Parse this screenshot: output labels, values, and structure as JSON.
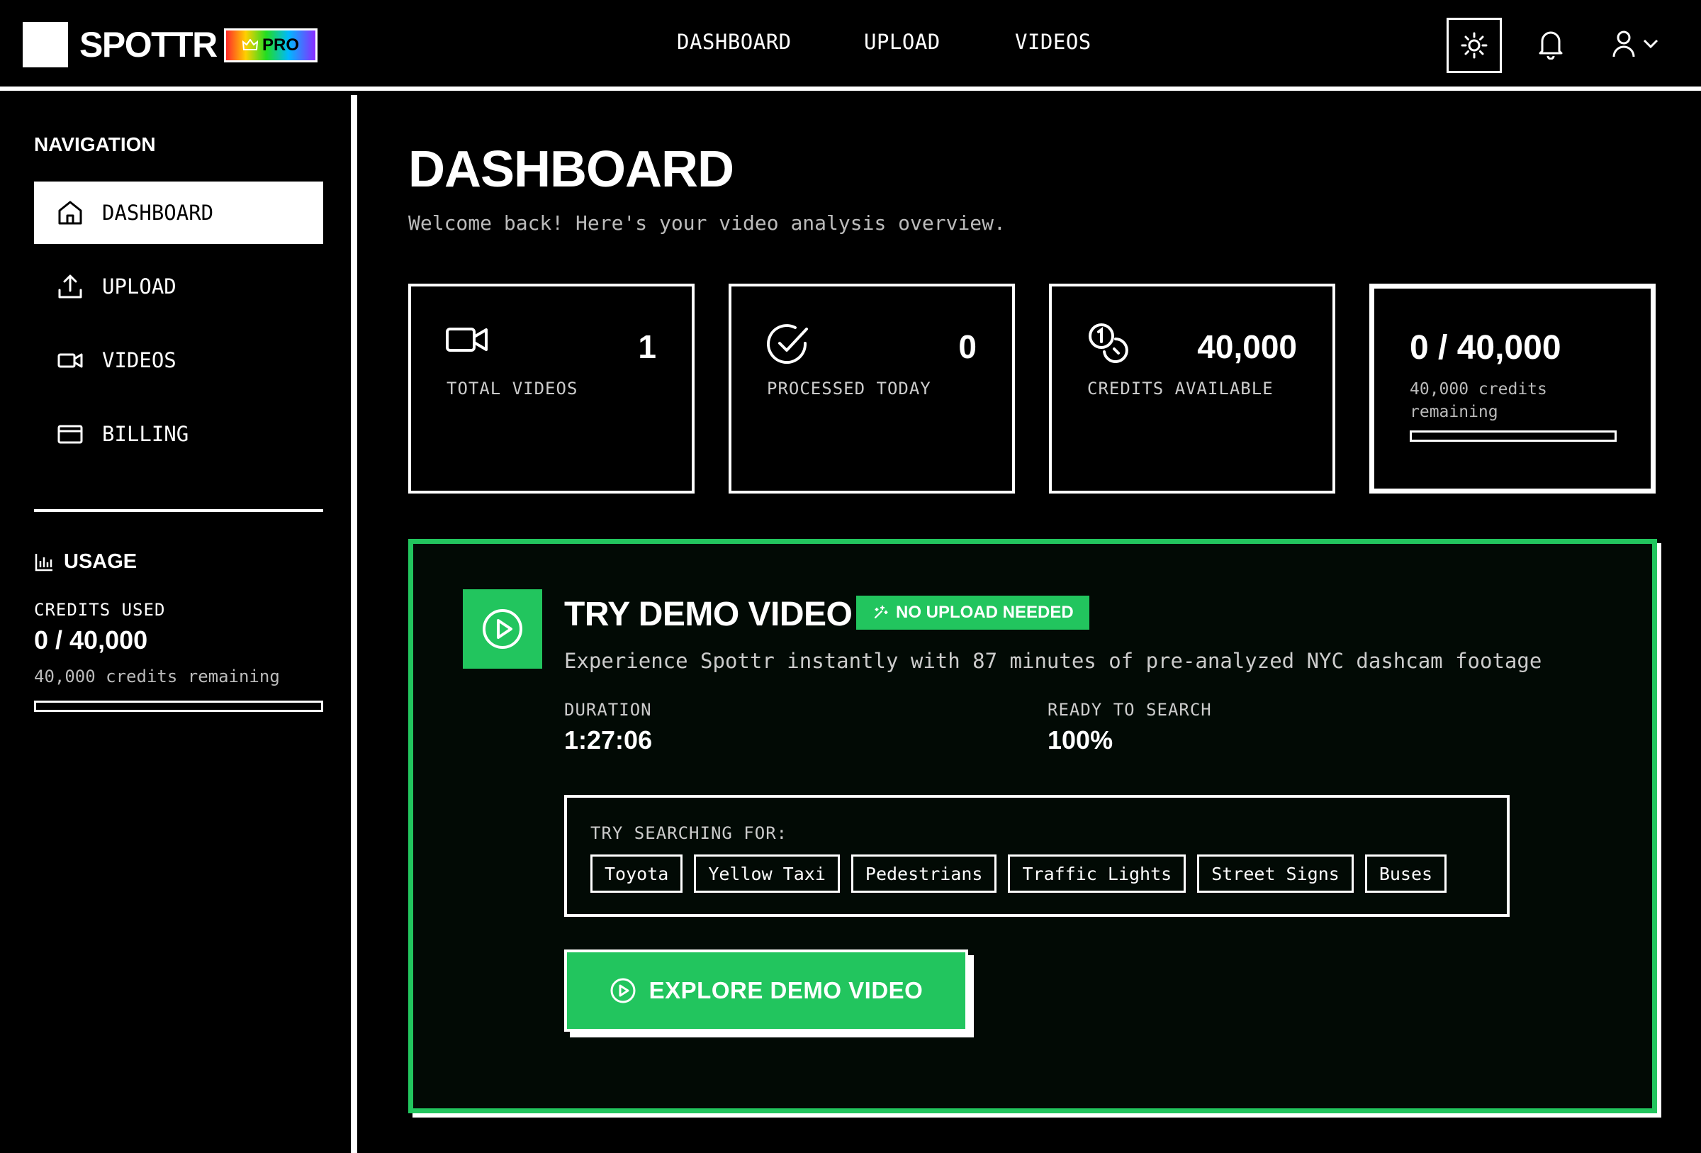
{
  "app": {
    "brand": "SPOTTR",
    "pro_label": "PRO"
  },
  "topnav": {
    "dashboard": "DASHBOARD",
    "upload": "UPLOAD",
    "videos": "VIDEOS"
  },
  "sidebar": {
    "title": "NAVIGATION",
    "items": [
      {
        "label": "DASHBOARD",
        "icon": "home-icon",
        "active": true
      },
      {
        "label": "UPLOAD",
        "icon": "upload-icon"
      },
      {
        "label": "VIDEOS",
        "icon": "video-camera-icon"
      },
      {
        "label": "BILLING",
        "icon": "credit-card-icon"
      }
    ],
    "usage": {
      "title": "USAGE",
      "credits_label": "CREDITS USED",
      "credits_value": "0 / 40,000",
      "remaining": "40,000 credits remaining",
      "fraction_used": 0
    }
  },
  "main": {
    "title": "DASHBOARD",
    "subtitle": "Welcome back! Here's your video analysis overview.",
    "stats": [
      {
        "value": "1",
        "label": "TOTAL VIDEOS",
        "icon": "video-camera-icon"
      },
      {
        "value": "0",
        "label": "PROCESSED TODAY",
        "icon": "check-circle-icon"
      },
      {
        "value": "40,000",
        "label": "CREDITS AVAILABLE",
        "icon": "coins-icon"
      }
    ],
    "credits_card": {
      "value": "0 / 40,000",
      "remaining": "40,000 credits remaining",
      "fraction_used": 0
    }
  },
  "demo": {
    "title": "TRY DEMO VIDEO",
    "badge": "NO UPLOAD NEEDED",
    "description": "Experience Spottr instantly with 87 minutes of pre-analyzed NYC dashcam footage",
    "duration_label": "DURATION",
    "duration_value": "1:27:06",
    "ready_label": "READY TO SEARCH",
    "ready_value": "100%",
    "search_label": "TRY SEARCHING FOR:",
    "suggestions": [
      "Toyota",
      "Yellow Taxi",
      "Pedestrians",
      "Traffic Lights",
      "Street Signs",
      "Buses"
    ],
    "cta": "EXPLORE DEMO VIDEO"
  },
  "colors": {
    "accent": "#22c55e",
    "background": "#000000",
    "foreground": "#ffffff"
  }
}
